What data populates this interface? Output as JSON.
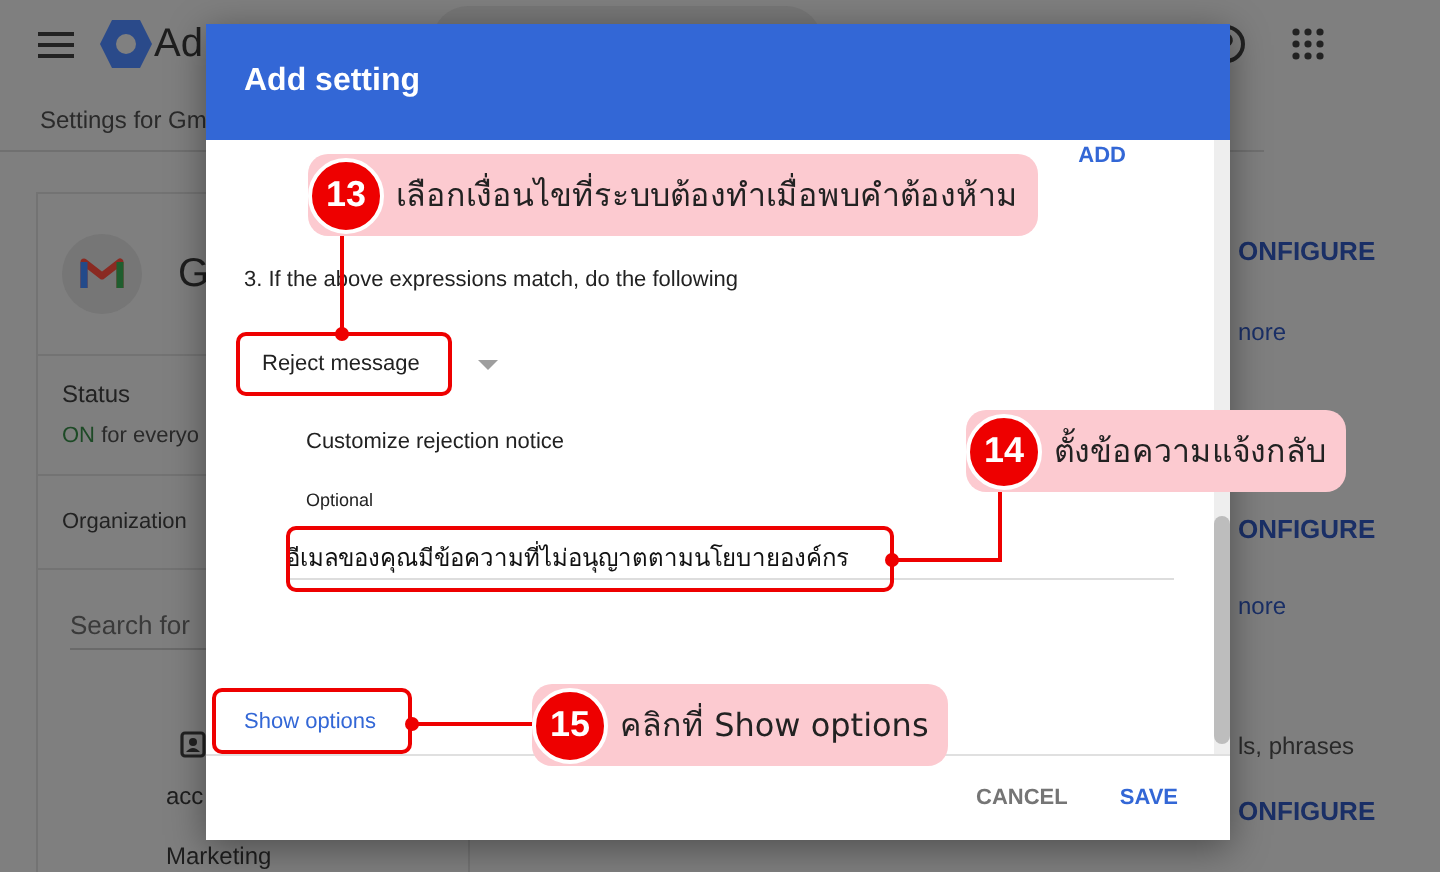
{
  "header": {
    "app_title": "Ad"
  },
  "breadcrumb": "Settings for Gm",
  "app_card": {
    "name": "G",
    "status_label": "Status",
    "status_value": "ON",
    "status_scope": "for everyo",
    "org_label": "Organization",
    "search_placeholder": "Search for",
    "org_units": [
      "acc",
      "Marketing"
    ]
  },
  "right_links": [
    {
      "kind": "action",
      "text": "ONFIGURE"
    },
    {
      "kind": "link",
      "text": "nore"
    },
    {
      "kind": "action",
      "text": "ONFIGURE"
    },
    {
      "kind": "link",
      "text": "nore"
    },
    {
      "kind": "text",
      "text": "ls, phrases"
    },
    {
      "kind": "action",
      "text": "ONFIGURE"
    }
  ],
  "dialog": {
    "title": "Add setting",
    "add_button": "ADD",
    "step_label": "3. If the above expressions match, do the following",
    "action_select": "Reject message",
    "notice_label": "Customize rejection notice",
    "notice_hint": "Optional",
    "notice_value": "อีเมลของคุณมีข้อความที่ไม่อนุญาตตามนโยบายองค์กร",
    "show_options": "Show options",
    "buttons": [
      {
        "kind": "secondary",
        "label": "CANCEL"
      },
      {
        "kind": "primary",
        "label": "SAVE"
      }
    ]
  },
  "callouts": [
    {
      "number": "13",
      "text": "เลือกเงื่อนไขที่ระบบต้องทำเมื่อพบคำต้องห้าม"
    },
    {
      "number": "14",
      "text": "ตั้งข้อความแจ้งกลับ"
    },
    {
      "number": "15",
      "text": "คลิกที่ Show options"
    }
  ]
}
